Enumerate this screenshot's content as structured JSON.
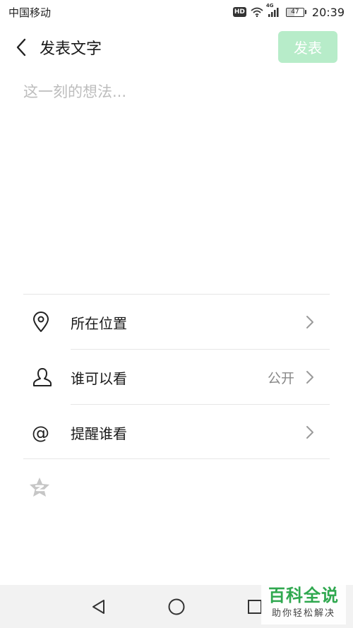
{
  "status_bar": {
    "carrier": "中国移动",
    "hd": "HD",
    "network": "4G",
    "battery": "47",
    "battery_level": 0.47,
    "time": "20:39"
  },
  "header": {
    "title": "发表文字",
    "publish_label": "发表"
  },
  "compose": {
    "placeholder": "这一刻的想法...",
    "value": ""
  },
  "options": [
    {
      "label": "所在位置",
      "value": "",
      "icon": "location-pin-icon"
    },
    {
      "label": "谁可以看",
      "value": "公开",
      "icon": "person-icon"
    },
    {
      "label": "提醒谁看",
      "value": "",
      "icon": "at-sign-icon"
    }
  ],
  "at_symbol": "@",
  "extra": {
    "icon": "qzone-star-icon"
  },
  "watermark": {
    "title": "百科全说",
    "subtitle": "助你轻松解决"
  },
  "colors": {
    "publish_bg": "#b7ecc9",
    "watermark_green": "#2fa84f",
    "nav_bg": "#f2f2f2"
  }
}
